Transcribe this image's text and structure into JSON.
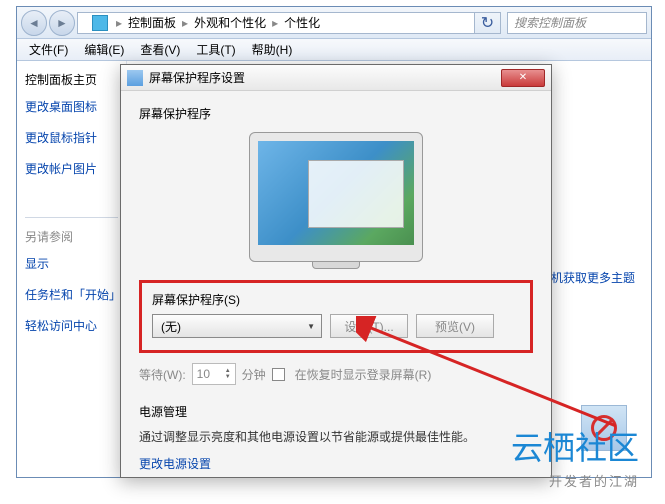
{
  "explorer": {
    "breadcrumb": [
      "控制面板",
      "外观和个性化",
      "个性化"
    ],
    "search_placeholder": "搜索控制面板",
    "menu": {
      "file": "文件(F)",
      "edit": "编辑(E)",
      "view": "查看(V)",
      "tools": "工具(T)",
      "help": "帮助(H)"
    },
    "sidebar": {
      "home": "控制面板主页",
      "links": [
        "更改桌面图标",
        "更改鼠标指针",
        "更改帐户图片"
      ],
      "also_label": "另请参阅",
      "also_links": [
        "显示",
        "任务栏和「开始」",
        "轻松访问中心"
      ]
    },
    "right_link": "联机获取更多主题"
  },
  "dialog": {
    "title": "屏幕保护程序设置",
    "section": "屏幕保护程序",
    "saver_label": "屏幕保护程序(S)",
    "saver_value": "(无)",
    "settings_btn": "设置(T)...",
    "preview_btn": "预览(V)",
    "wait_label": "等待(W):",
    "wait_value": "10",
    "wait_unit": "分钟",
    "resume_checkbox": "在恢复时显示登录屏幕(R)",
    "power_title": "电源管理",
    "power_desc": "通过调整显示亮度和其他电源设置以节省能源或提供最佳性能。",
    "power_link": "更改电源设置"
  },
  "watermark": {
    "main": "云栖社区",
    "sub": "开发者的江湖"
  }
}
